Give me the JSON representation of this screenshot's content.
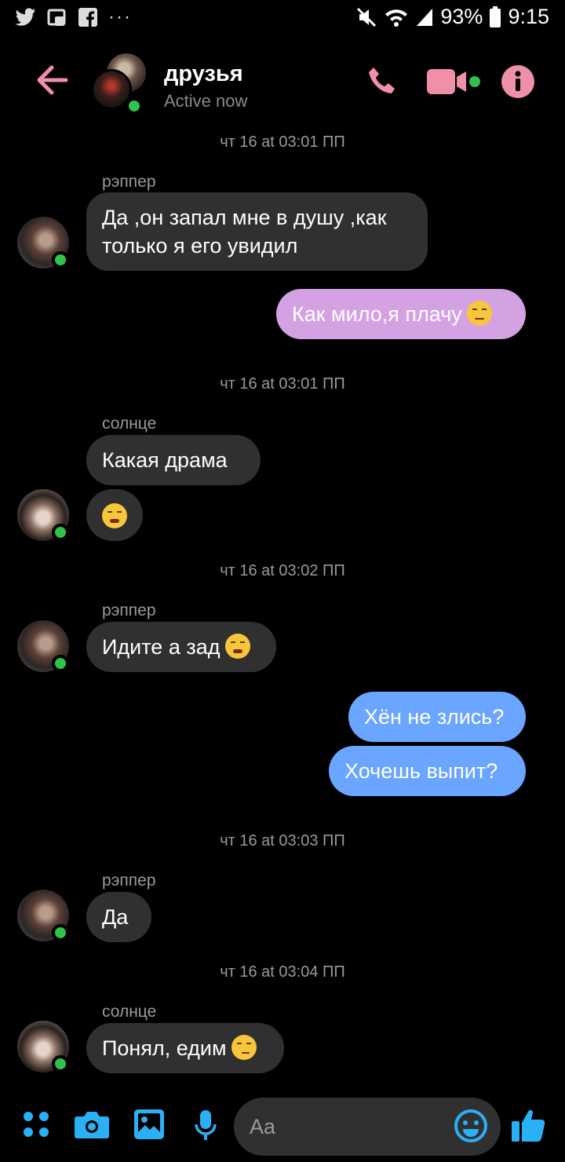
{
  "status_bar": {
    "left_icons": [
      "twitter-icon",
      "portfolio-icon",
      "facebook-icon",
      "more-notifications-icon"
    ],
    "more": "···",
    "battery": "93%",
    "time": "9:15"
  },
  "header": {
    "title": "друзья",
    "subtitle": "Active now",
    "accent": "#f08fa8"
  },
  "messages": {
    "ts1": "чт 16 at 03:01 ПП",
    "s1": "рэппер",
    "m1": "Да ,он запал мне в душу ,как только я его увидил",
    "m2": "Как мило,я плачу",
    "ts2": "чт 16 at 03:01 ПП",
    "s2": "солнце",
    "m3": "Какая драма",
    "ts3": "чт 16 at 03:02 ПП",
    "s3": "рэппер",
    "m5": "Идите а зад",
    "m6": "Хён не злись?",
    "m7": "Хочешь выпит?",
    "ts4": "чт 16 at 03:03 ПП",
    "s4": "рэппер",
    "m8": "Да",
    "ts5": "чт 16 at 03:04 ПП",
    "s5": "солнце",
    "m9": "Понял, едим"
  },
  "composer": {
    "placeholder": "Aa",
    "icon_color": "#2ab0f5"
  },
  "colors": {
    "outgoing_pink": "#d4a2e3",
    "outgoing_blue": "#6aa5ff",
    "incoming": "#303030",
    "online": "#31c24b"
  }
}
